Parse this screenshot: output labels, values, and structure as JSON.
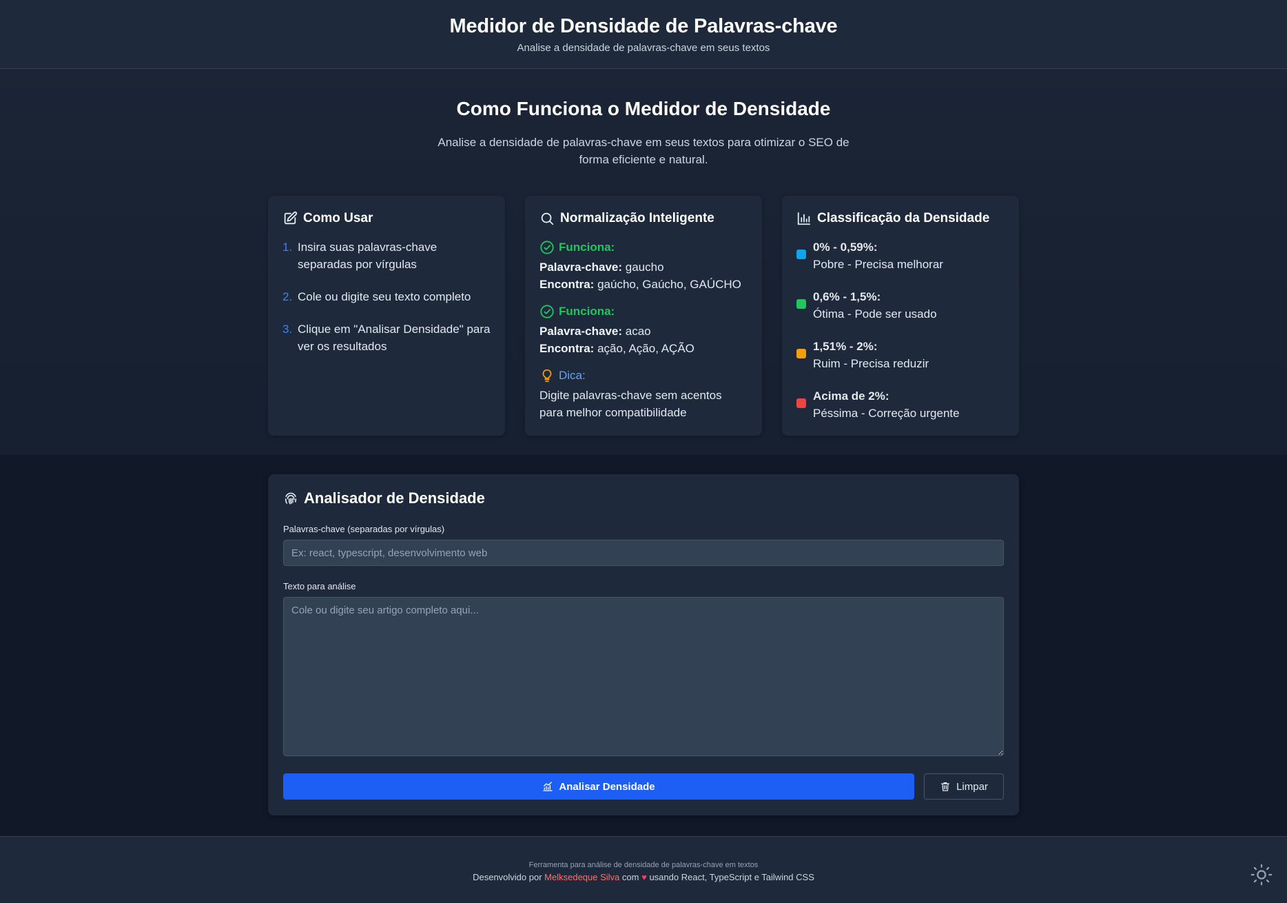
{
  "header": {
    "title": "Medidor de Densidade de Palavras-chave",
    "subtitle": "Analise a densidade de palavras-chave em seus textos"
  },
  "how": {
    "title": "Como Funciona o Medidor de Densidade",
    "intro": "Analise a densidade de palavras-chave em seus textos para otimizar o SEO de forma eficiente e natural.",
    "usage": {
      "title": "Como Usar",
      "steps": [
        {
          "num": "1.",
          "text": "Insira suas palavras-chave separadas por vírgulas"
        },
        {
          "num": "2.",
          "text": "Cole ou digite seu texto completo"
        },
        {
          "num": "3.",
          "text": "Clique em \"Analisar Densidade\" para ver os resultados"
        }
      ]
    },
    "normalization": {
      "title": "Normalização Inteligente",
      "examples": [
        {
          "label": "Funciona:",
          "kw_label": "Palavra-chave:",
          "kw": "gaucho",
          "finds_label": "Encontra:",
          "finds": "gaúcho, Gaúcho, GAÚCHO"
        },
        {
          "label": "Funciona:",
          "kw_label": "Palavra-chave:",
          "kw": "acao",
          "finds_label": "Encontra:",
          "finds": "ação, Ação, AÇÃO"
        }
      ],
      "tip_label": "Dica:",
      "tip_text": "Digite palavras-chave sem acentos para melhor compatibilidade"
    },
    "classification": {
      "title": "Classificação da Densidade",
      "items": [
        {
          "range": "0% - 0,59%:",
          "desc": "Pobre - Precisa melhorar",
          "color": "#0ea5e9"
        },
        {
          "range": "0,6% - 1,5%:",
          "desc": "Ótima - Pode ser usado",
          "color": "#22c55e"
        },
        {
          "range": "1,51% - 2%:",
          "desc": "Ruim - Precisa reduzir",
          "color": "#f59e0b"
        },
        {
          "range": "Acima de 2%:",
          "desc": "Péssima - Correção urgente",
          "color": "#ef4444"
        }
      ]
    }
  },
  "analyzer": {
    "title": "Analisador de Densidade",
    "keywords_label": "Palavras-chave (separadas por vírgulas)",
    "keywords_placeholder": "Ex: react, typescript, desenvolvimento web",
    "keywords_value": "",
    "text_label": "Texto para análise",
    "text_placeholder": "Cole ou digite seu artigo completo aqui...",
    "text_value": "",
    "analyze_label": "Analisar Densidade",
    "clear_label": "Limpar"
  },
  "footer": {
    "line1": "Ferramenta para análise de densidade de palavras-chave em textos",
    "prefix": "Desenvolvido por",
    "author": "Melksedeque Silva",
    "with": "com",
    "heart": "♥",
    "suffix": "usando React, TypeScript e Tailwind CSS"
  },
  "icons": {
    "usage": "edit-icon",
    "normalization": "search-icon",
    "classification": "bar-chart-icon",
    "check": "check-circle-icon",
    "tip": "lightbulb-icon",
    "analyzer": "fingerprint-icon",
    "analyze": "chart-line-icon",
    "clear": "trash-icon",
    "theme": "sun-icon"
  },
  "colors": {
    "accent": "#1d5ff5",
    "success": "#22c55e",
    "info": "#60a5fa",
    "warning": "#f59e0b",
    "danger": "#ef4444"
  }
}
